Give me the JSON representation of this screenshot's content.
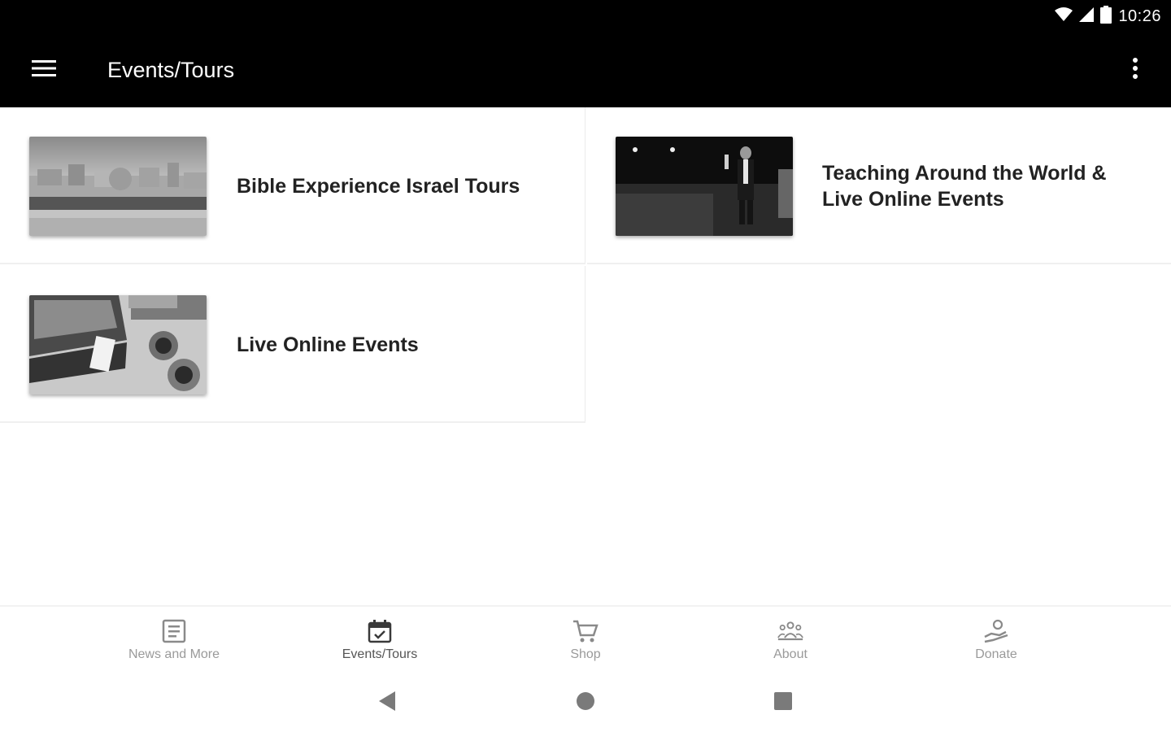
{
  "status_bar": {
    "time": "10:26",
    "icons": [
      "wifi-icon",
      "cell-signal-icon",
      "battery-icon"
    ]
  },
  "app_bar": {
    "title": "Events/Tours",
    "menu_icon": "hamburger-menu-icon",
    "overflow_icon": "more-vert-icon"
  },
  "cards": [
    {
      "title": "Bible Experience Israel Tours",
      "image": "jerusalem-skyline-photo"
    },
    {
      "title": "Teaching Around the World & Live Online Events",
      "image": "speaker-on-stage-photo"
    },
    {
      "title": "Live Online Events",
      "image": "laptop-desk-photo"
    }
  ],
  "bottom_nav": {
    "items": [
      {
        "label": "News and More",
        "icon": "article-icon",
        "active": false
      },
      {
        "label": "Events/Tours",
        "icon": "calendar-check-icon",
        "active": true
      },
      {
        "label": "Shop",
        "icon": "cart-icon",
        "active": false
      },
      {
        "label": "About",
        "icon": "group-icon",
        "active": false
      },
      {
        "label": "Donate",
        "icon": "donate-hand-icon",
        "active": false
      }
    ]
  },
  "system_nav": {
    "buttons": [
      "back-icon",
      "home-icon",
      "recents-icon"
    ]
  },
  "colors": {
    "app_bar": "#000000",
    "background": "#ffffff",
    "card_title": "#222222",
    "nav_inactive": "#9a9a9a",
    "nav_active": "#555555"
  }
}
